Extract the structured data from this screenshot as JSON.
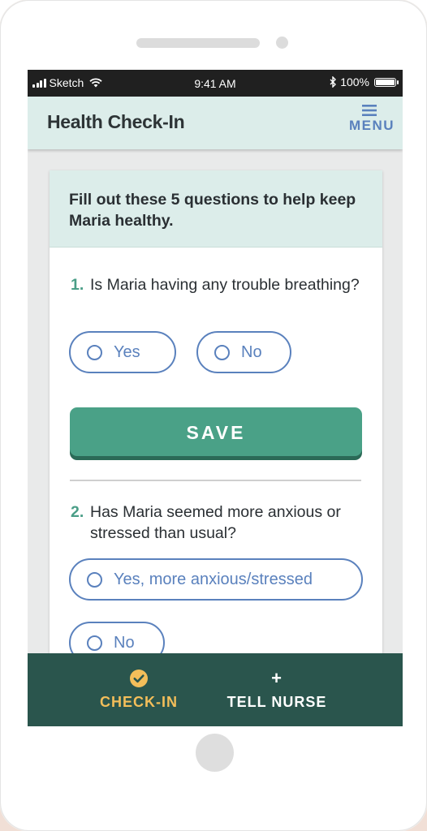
{
  "status_bar": {
    "carrier": "Sketch",
    "time": "9:41 AM",
    "battery_text": "100%"
  },
  "header": {
    "title": "Health Check-In",
    "menu_label": "MENU"
  },
  "form": {
    "intro": "Fill out these 5 questions to help keep Maria healthy.",
    "questions": [
      {
        "number": "1.",
        "text": "Is Maria having any trouble breathing?",
        "options": [
          "Yes",
          "No"
        ]
      },
      {
        "number": "2.",
        "text": "Has Maria seemed more anxious or stressed than usual?",
        "options": [
          "Yes, more anxious/stressed",
          "No"
        ]
      }
    ],
    "save_label": "SAVE"
  },
  "bottom_nav": {
    "items": [
      {
        "label": "CHECK-IN",
        "icon": "check-circle-icon",
        "active": true
      },
      {
        "label": "TELL NURSE",
        "icon": "plus-icon",
        "active": false
      }
    ]
  },
  "colors": {
    "accent_green": "#4aa187",
    "nav_dark": "#2a554d",
    "link_blue": "#5a81bd",
    "active_gold": "#f3be5a",
    "header_mint": "#dcedea"
  }
}
